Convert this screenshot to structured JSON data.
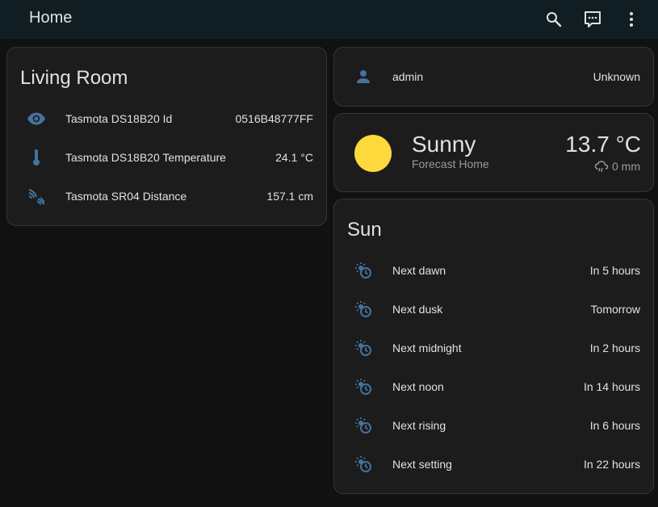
{
  "header": {
    "title": "Home",
    "search_icon": "magnify-icon",
    "assist_icon": "comment-processing-icon",
    "menu_icon": "dots-vertical-icon"
  },
  "living_room": {
    "title": "Living Room",
    "rows": [
      {
        "icon": "eye-icon",
        "label": "Tasmota DS18B20 Id",
        "value": "0516B48777FF"
      },
      {
        "icon": "thermometer-icon",
        "label": "Tasmota DS18B20 Temperature",
        "value": "24.1 °C"
      },
      {
        "icon": "signal-distance-icon",
        "label": "Tasmota SR04 Distance",
        "value": "157.1 cm"
      }
    ]
  },
  "person": {
    "icon": "account-icon",
    "name": "admin",
    "state": "Unknown"
  },
  "weather": {
    "icon": "sunny-icon",
    "condition": "Sunny",
    "location": "Forecast Home",
    "temperature": "13.7 °C",
    "precipitation": "0 mm",
    "precip_icon": "weather-rainy-icon",
    "sun_color": "#fdd93c"
  },
  "sun": {
    "title": "Sun",
    "rows": [
      {
        "icon": "sun-clock-icon",
        "label": "Next dawn",
        "value": "In 5 hours"
      },
      {
        "icon": "sun-clock-icon",
        "label": "Next dusk",
        "value": "Tomorrow"
      },
      {
        "icon": "sun-clock-icon",
        "label": "Next midnight",
        "value": "In 2 hours"
      },
      {
        "icon": "sun-clock-icon",
        "label": "Next noon",
        "value": "In 14 hours"
      },
      {
        "icon": "sun-clock-icon",
        "label": "Next rising",
        "value": "In 6 hours"
      },
      {
        "icon": "sun-clock-icon",
        "label": "Next setting",
        "value": "In 22 hours"
      }
    ]
  },
  "colors": {
    "icon_blue": "#44739e",
    "toolbar": "#101e24",
    "card": "#1c1c1c"
  }
}
